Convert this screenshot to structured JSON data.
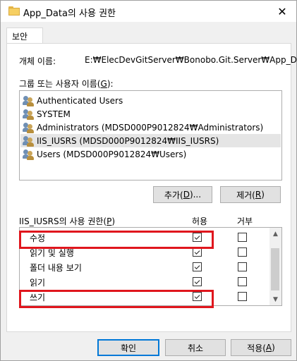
{
  "window": {
    "title": "App_Data의 사용 권한",
    "close_glyph": "✕"
  },
  "tabs": [
    {
      "label": "보안"
    }
  ],
  "object": {
    "label": "개체 이름:",
    "value": "E:₩ElecDevGitServer₩Bonobo.Git.Server₩App_Data"
  },
  "groups": {
    "label_pre": "그룹 또는 사용자 이름(",
    "label_key": "G",
    "label_post": "):",
    "items": [
      {
        "name": "Authenticated Users",
        "selected": false
      },
      {
        "name": "SYSTEM",
        "selected": false
      },
      {
        "name": "Administrators (MDSD000P9012824₩Administrators)",
        "selected": false
      },
      {
        "name": "IIS_IUSRS (MDSD000P9012824₩IIS_IUSRS)",
        "selected": true
      },
      {
        "name": "Users (MDSD000P9012824₩Users)",
        "selected": false
      }
    ]
  },
  "buttons": {
    "add_pre": "추가(",
    "add_key": "D",
    "add_post": ")...",
    "remove_pre": "제거(",
    "remove_key": "R",
    "remove_post": ")",
    "ok": "확인",
    "cancel": "취소",
    "apply_pre": "적용(",
    "apply_key": "A",
    "apply_post": ")"
  },
  "permissions": {
    "label_pre": "IIS_IUSRS의 사용 권한(",
    "label_key": "P",
    "label_post": ")",
    "allow_header": "허용",
    "deny_header": "거부",
    "rows": [
      {
        "name": "수정",
        "allow": true,
        "deny": false,
        "highlighted": true
      },
      {
        "name": "읽기 및 실행",
        "allow": true,
        "deny": false,
        "highlighted": false
      },
      {
        "name": "폴더 내용 보기",
        "allow": true,
        "deny": false,
        "highlighted": false
      },
      {
        "name": "읽기",
        "allow": true,
        "deny": false,
        "highlighted": false
      },
      {
        "name": "쓰기",
        "allow": true,
        "deny": false,
        "highlighted": true
      }
    ]
  },
  "colors": {
    "highlight": "#e0161d",
    "accent": "#0078d7"
  },
  "icons": {
    "folder": "folder-icon",
    "user": "users-icon",
    "close": "close-icon"
  }
}
